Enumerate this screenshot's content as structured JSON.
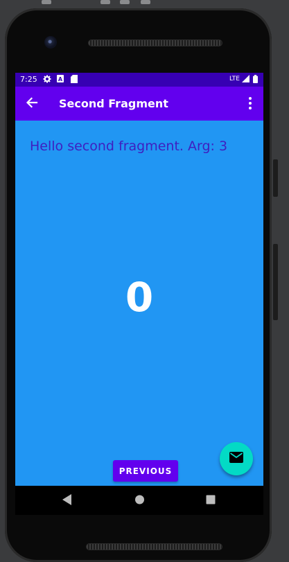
{
  "status_bar": {
    "time": "7:25",
    "network": "LTE",
    "icons": [
      "settings-icon",
      "a-icon",
      "sd-card-icon",
      "signal-icon",
      "battery-icon"
    ]
  },
  "app_bar": {
    "title": "Second Fragment",
    "icons": [
      "back-arrow-icon",
      "more-vert-icon"
    ]
  },
  "content": {
    "hello_text": "Hello second fragment. Arg: 3",
    "counter": "0",
    "previous_button": "PREVIOUS",
    "fab_icon": "email-icon"
  },
  "navigation_bar": {
    "icons": [
      "back-triangle-icon",
      "home-circle-icon",
      "recents-square-icon"
    ]
  },
  "colors": {
    "primary": "#6200ee",
    "primary_dark": "#3700b3",
    "background": "#2196f3",
    "fab": "#03dac5",
    "hello_text": "#3f1fc0"
  }
}
